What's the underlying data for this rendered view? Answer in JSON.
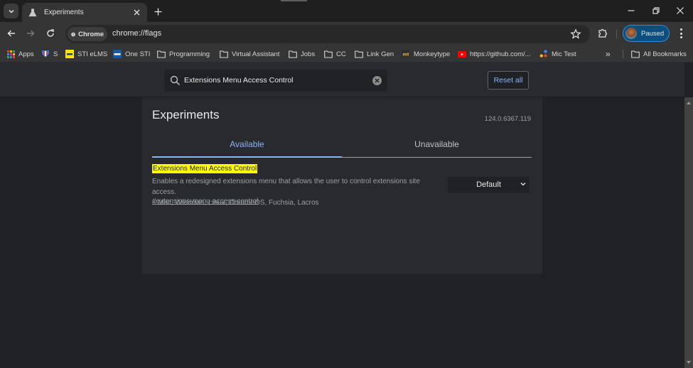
{
  "browser": {
    "tab": {
      "title": "Experiments",
      "icon": "flask-icon"
    },
    "toolbar": {
      "chip_label": "Chrome",
      "url": "chrome://flags",
      "profile_label": "Paused"
    },
    "bookmarks": [
      {
        "label": "Apps",
        "icon": "apps-grid-icon"
      },
      {
        "label": "S",
        "icon": "shield-favicon"
      },
      {
        "label": "STI eLMS",
        "icon": "sti-favicon"
      },
      {
        "label": "One STI",
        "icon": "one-sti-favicon"
      },
      {
        "label": "Programming",
        "icon": "folder-icon"
      },
      {
        "label": "Virtual Assistant",
        "icon": "folder-icon"
      },
      {
        "label": "Jobs",
        "icon": "folder-icon"
      },
      {
        "label": "CC",
        "icon": "folder-icon"
      },
      {
        "label": "Link Gen",
        "icon": "folder-icon"
      },
      {
        "label": "Monkeytype",
        "icon": "monkeytype-favicon"
      },
      {
        "label": "https://github.com/...",
        "icon": "youtube-favicon"
      },
      {
        "label": "Mic Test",
        "icon": "mic-test-favicon"
      }
    ],
    "overflow_label": "»",
    "all_bookmarks_label": "All Bookmarks"
  },
  "flags": {
    "search": {
      "value": "Extensions Menu Access Control"
    },
    "reset_label": "Reset all",
    "title": "Experiments",
    "version": "124.0.6367.119",
    "tabs": [
      {
        "label": "Available",
        "active": true
      },
      {
        "label": "Unavailable",
        "active": false
      }
    ],
    "entry": {
      "name": "Extensions Menu Access Control",
      "description": "Enables a redesigned extensions menu that allows the user to control extensions site access.",
      "platforms": "– Mac, Windows, Linux, ChromeOS, Fuchsia, Lacros",
      "anchor": "#extensions-menu-access-control",
      "selected_option": "Default"
    }
  },
  "colors": {
    "accent": "#8ab4f8",
    "highlight": "#ffff00",
    "profile_bg": "#0b4f7e"
  }
}
